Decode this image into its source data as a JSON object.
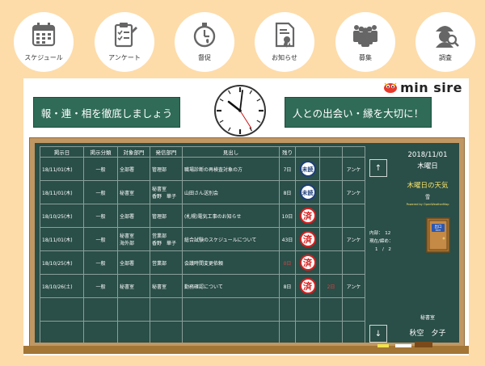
{
  "nav": [
    {
      "name": "schedule",
      "label": "スケジュール",
      "icon": "calendar-icon"
    },
    {
      "name": "survey",
      "label": "アンケート",
      "icon": "clipboard-icon"
    },
    {
      "name": "reminder",
      "label": "督促",
      "icon": "stopwatch-icon"
    },
    {
      "name": "notice",
      "label": "お知らせ",
      "icon": "certificate-icon"
    },
    {
      "name": "recruit",
      "label": "募集",
      "icon": "people-icon"
    },
    {
      "name": "investigate",
      "label": "調査",
      "icon": "detective-icon"
    }
  ],
  "brand": {
    "text": "min sire"
  },
  "slogans": {
    "left": "報・連・相を徹底しましょう",
    "right": "人との出会い・縁を大切に！"
  },
  "table": {
    "headers": [
      "掲示日",
      "掲示分類",
      "対象部門",
      "発信部門",
      "見出し",
      "残り",
      "",
      "",
      ""
    ],
    "rows": [
      {
        "date": "18/11/01(木)",
        "category": "一般",
        "target": [
          "全部署"
        ],
        "sender": [
          "管理部"
        ],
        "title": "職場診断の再検査対象の方",
        "remaining": "7日",
        "remaining_red": false,
        "status": "未読",
        "status_type": "blue",
        "extra": "",
        "anke": "アンケ"
      },
      {
        "date": "18/11/01(木)",
        "category": "一般",
        "target": [
          "秘書室"
        ],
        "sender": [
          "秘書室",
          "香野　華子"
        ],
        "title": "山田さん送別会",
        "remaining": "8日",
        "remaining_red": false,
        "status": "未読",
        "status_type": "blue",
        "extra": "",
        "anke": "アンケ"
      },
      {
        "date": "18/10/25(木)",
        "category": "一般",
        "target": [
          "全部署"
        ],
        "sender": [
          "管理部"
        ],
        "title": "(札幌)電気工事のお知らせ",
        "remaining": "10日",
        "remaining_red": false,
        "status": "済",
        "status_type": "red",
        "extra": "",
        "anke": ""
      },
      {
        "date": "18/11/01(木)",
        "category": "一般",
        "target": [
          "秘書室",
          "海外部"
        ],
        "sender": [
          "営業部",
          "香野　華子"
        ],
        "title": "総合試験のスケジュールについて",
        "remaining": "43日",
        "remaining_red": false,
        "status": "済",
        "status_type": "red",
        "extra": "",
        "anke": "アンケ"
      },
      {
        "date": "18/10/25(木)",
        "category": "一般",
        "target": [
          "全部署"
        ],
        "sender": [
          "営業部"
        ],
        "title": "会議時間変更依頼",
        "remaining": "0日",
        "remaining_red": true,
        "status": "済",
        "status_type": "red",
        "extra": "",
        "anke": ""
      },
      {
        "date": "18/10/26(土)",
        "category": "一般",
        "target": [
          "秘書室"
        ],
        "sender": [
          "秘書室"
        ],
        "title": "勤務確認について",
        "remaining": "8日",
        "remaining_red": false,
        "status": "済",
        "status_type": "red",
        "extra": "2日",
        "anke": "アンケ"
      },
      {
        "date": "",
        "category": "",
        "target": [
          ""
        ],
        "sender": [
          ""
        ],
        "title": "",
        "remaining": "",
        "remaining_red": false,
        "status": "",
        "status_type": "",
        "extra": "",
        "anke": ""
      },
      {
        "date": "",
        "category": "",
        "target": [
          ""
        ],
        "sender": [
          ""
        ],
        "title": "",
        "remaining": "",
        "remaining_red": false,
        "status": "",
        "status_type": "",
        "extra": "",
        "anke": ""
      }
    ]
  },
  "side": {
    "up": "↑",
    "down": "↓",
    "date": "2018/11/01",
    "weekday": "木曜日",
    "weather_title": "木曜日の天気",
    "weather_value": "雪",
    "powered_by": "Powered by OpenWeatherMap",
    "stat1": "内部：　12",
    "stat2": "現在/締め：",
    "stat3": "1　/　2",
    "door_label": "出口",
    "door_sub": "EXIT",
    "dept": "秘書室",
    "person": "秋空　夕子"
  },
  "colors": {
    "board": "#2a4e48",
    "slogan": "#2f6b57",
    "frame": "#c09662",
    "bg": "#fddcaa",
    "accent_red": "#d91f1f",
    "accent_blue": "#1d3f7a"
  }
}
